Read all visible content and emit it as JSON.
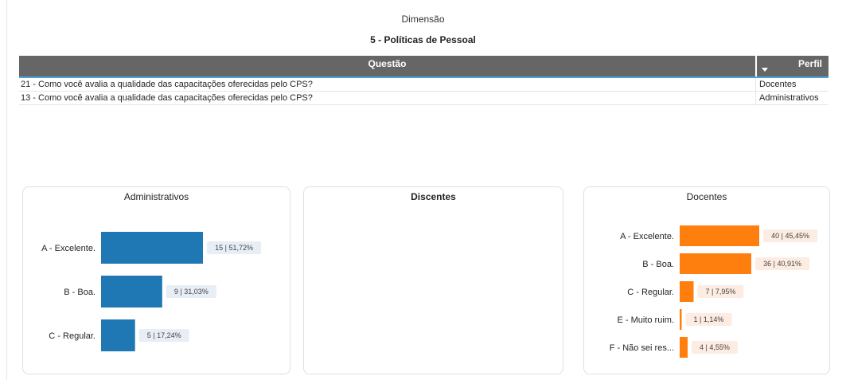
{
  "header": {
    "dimension_label": "Dimensão",
    "dimension_value": "5 - Políticas de Pessoal"
  },
  "table": {
    "columns": [
      "Questão",
      "Perfil"
    ],
    "rows": [
      {
        "questao": "21 - Como você avalia a qualidade das capacitações oferecidas pelo CPS?",
        "perfil": "Docentes"
      },
      {
        "questao": "13 - Como você avalia a qualidade das capacitações oferecidas pelo CPS?",
        "perfil": "Administrativos"
      }
    ]
  },
  "colors": {
    "administrativos": "#1f77b4",
    "docentes": "#ff7f0e",
    "label_bg_admin": "#e8eef5",
    "label_bg_doc": "#fdece2"
  },
  "chart_data": [
    {
      "type": "bar",
      "title": "Administrativos",
      "orientation": "horizontal",
      "categories": [
        "A - Excelente.",
        "B - Boa.",
        "C - Regular."
      ],
      "values": [
        15,
        9,
        5
      ],
      "data_labels": [
        "15 | 51,72%",
        "9 | 31,03%",
        "5 | 17,24%"
      ]
    },
    {
      "type": "bar",
      "title": "Discentes",
      "orientation": "horizontal",
      "categories": [],
      "values": [],
      "data_labels": []
    },
    {
      "type": "bar",
      "title": "Docentes",
      "orientation": "horizontal",
      "categories": [
        "A - Excelente.",
        "B - Boa.",
        "C - Regular.",
        "E - Muito ruim.",
        "F - Não sei res..."
      ],
      "values": [
        40,
        36,
        7,
        1,
        4
      ],
      "data_labels": [
        "40 | 45,45%",
        "36 | 40,91%",
        "7 | 7,95%",
        "1 | 1,14%",
        "4 | 4,55%"
      ]
    }
  ]
}
